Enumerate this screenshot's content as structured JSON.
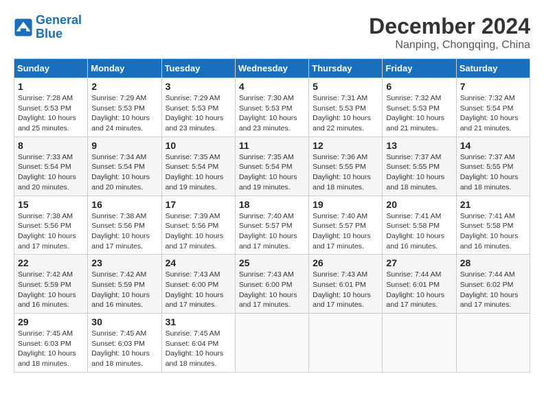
{
  "header": {
    "logo_line1": "General",
    "logo_line2": "Blue",
    "month_title": "December 2024",
    "location": "Nanping, Chongqing, China"
  },
  "days_of_week": [
    "Sunday",
    "Monday",
    "Tuesday",
    "Wednesday",
    "Thursday",
    "Friday",
    "Saturday"
  ],
  "weeks": [
    [
      {
        "day": "1",
        "sunrise": "7:28 AM",
        "sunset": "5:53 PM",
        "daylight": "10 hours and 25 minutes."
      },
      {
        "day": "2",
        "sunrise": "7:29 AM",
        "sunset": "5:53 PM",
        "daylight": "10 hours and 24 minutes."
      },
      {
        "day": "3",
        "sunrise": "7:29 AM",
        "sunset": "5:53 PM",
        "daylight": "10 hours and 23 minutes."
      },
      {
        "day": "4",
        "sunrise": "7:30 AM",
        "sunset": "5:53 PM",
        "daylight": "10 hours and 23 minutes."
      },
      {
        "day": "5",
        "sunrise": "7:31 AM",
        "sunset": "5:53 PM",
        "daylight": "10 hours and 22 minutes."
      },
      {
        "day": "6",
        "sunrise": "7:32 AM",
        "sunset": "5:53 PM",
        "daylight": "10 hours and 21 minutes."
      },
      {
        "day": "7",
        "sunrise": "7:32 AM",
        "sunset": "5:54 PM",
        "daylight": "10 hours and 21 minutes."
      }
    ],
    [
      {
        "day": "8",
        "sunrise": "7:33 AM",
        "sunset": "5:54 PM",
        "daylight": "10 hours and 20 minutes."
      },
      {
        "day": "9",
        "sunrise": "7:34 AM",
        "sunset": "5:54 PM",
        "daylight": "10 hours and 20 minutes."
      },
      {
        "day": "10",
        "sunrise": "7:35 AM",
        "sunset": "5:54 PM",
        "daylight": "10 hours and 19 minutes."
      },
      {
        "day": "11",
        "sunrise": "7:35 AM",
        "sunset": "5:54 PM",
        "daylight": "10 hours and 19 minutes."
      },
      {
        "day": "12",
        "sunrise": "7:36 AM",
        "sunset": "5:55 PM",
        "daylight": "10 hours and 18 minutes."
      },
      {
        "day": "13",
        "sunrise": "7:37 AM",
        "sunset": "5:55 PM",
        "daylight": "10 hours and 18 minutes."
      },
      {
        "day": "14",
        "sunrise": "7:37 AM",
        "sunset": "5:55 PM",
        "daylight": "10 hours and 18 minutes."
      }
    ],
    [
      {
        "day": "15",
        "sunrise": "7:38 AM",
        "sunset": "5:56 PM",
        "daylight": "10 hours and 17 minutes."
      },
      {
        "day": "16",
        "sunrise": "7:38 AM",
        "sunset": "5:56 PM",
        "daylight": "10 hours and 17 minutes."
      },
      {
        "day": "17",
        "sunrise": "7:39 AM",
        "sunset": "5:56 PM",
        "daylight": "10 hours and 17 minutes."
      },
      {
        "day": "18",
        "sunrise": "7:40 AM",
        "sunset": "5:57 PM",
        "daylight": "10 hours and 17 minutes."
      },
      {
        "day": "19",
        "sunrise": "7:40 AM",
        "sunset": "5:57 PM",
        "daylight": "10 hours and 17 minutes."
      },
      {
        "day": "20",
        "sunrise": "7:41 AM",
        "sunset": "5:58 PM",
        "daylight": "10 hours and 16 minutes."
      },
      {
        "day": "21",
        "sunrise": "7:41 AM",
        "sunset": "5:58 PM",
        "daylight": "10 hours and 16 minutes."
      }
    ],
    [
      {
        "day": "22",
        "sunrise": "7:42 AM",
        "sunset": "5:59 PM",
        "daylight": "10 hours and 16 minutes."
      },
      {
        "day": "23",
        "sunrise": "7:42 AM",
        "sunset": "5:59 PM",
        "daylight": "10 hours and 16 minutes."
      },
      {
        "day": "24",
        "sunrise": "7:43 AM",
        "sunset": "6:00 PM",
        "daylight": "10 hours and 17 minutes."
      },
      {
        "day": "25",
        "sunrise": "7:43 AM",
        "sunset": "6:00 PM",
        "daylight": "10 hours and 17 minutes."
      },
      {
        "day": "26",
        "sunrise": "7:43 AM",
        "sunset": "6:01 PM",
        "daylight": "10 hours and 17 minutes."
      },
      {
        "day": "27",
        "sunrise": "7:44 AM",
        "sunset": "6:01 PM",
        "daylight": "10 hours and 17 minutes."
      },
      {
        "day": "28",
        "sunrise": "7:44 AM",
        "sunset": "6:02 PM",
        "daylight": "10 hours and 17 minutes."
      }
    ],
    [
      {
        "day": "29",
        "sunrise": "7:45 AM",
        "sunset": "6:03 PM",
        "daylight": "10 hours and 18 minutes."
      },
      {
        "day": "30",
        "sunrise": "7:45 AM",
        "sunset": "6:03 PM",
        "daylight": "10 hours and 18 minutes."
      },
      {
        "day": "31",
        "sunrise": "7:45 AM",
        "sunset": "6:04 PM",
        "daylight": "10 hours and 18 minutes."
      },
      null,
      null,
      null,
      null
    ]
  ]
}
